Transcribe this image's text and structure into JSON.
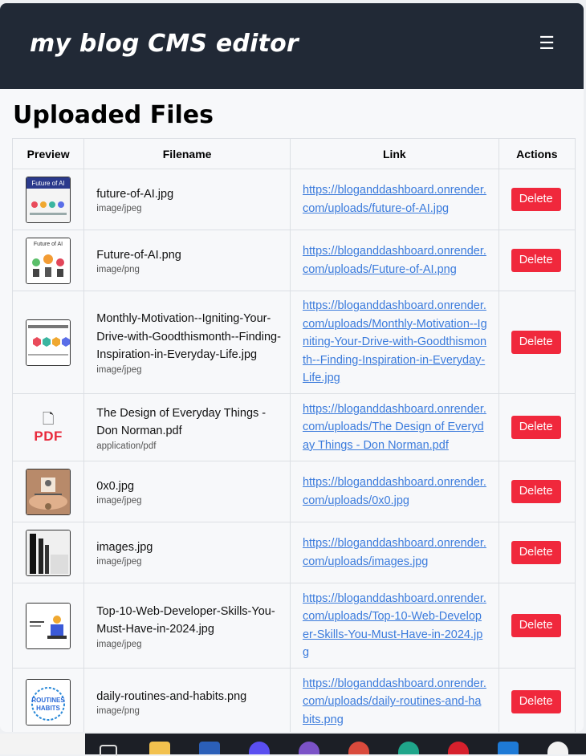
{
  "app": {
    "brand": "my blog CMS editor",
    "menu_glyph": "☰"
  },
  "page": {
    "title": "Uploaded Files"
  },
  "table": {
    "headers": {
      "preview": "Preview",
      "filename": "Filename",
      "link": "Link",
      "actions": "Actions"
    },
    "delete_label": "Delete",
    "rows": [
      {
        "name": "future-of-AI.jpg",
        "type": "image/jpeg",
        "url": "https://bloganddashboard.onrender.com/uploads/future-of-AI.jpg",
        "thumb": "ai-infographic",
        "delete": "Delete"
      },
      {
        "name": "Future-of-AI.png",
        "type": "image/png",
        "url": "https://bloganddashboard.onrender.com/uploads/Future-of-AI.png",
        "thumb": "ai-people",
        "delete": "Delete"
      },
      {
        "name": "Monthly-Motivation--Igniting-Your-Drive-with-Goodthismonth--Finding-Inspiration-in-Everyday-Life.jpg",
        "type": "image/jpeg",
        "url": "https://bloganddashboard.onrender.com/uploads/Monthly-Motivation--Igniting-Your-Drive-with-Goodthismonth--Finding-Inspiration-in-Everyday-Life.jpg",
        "thumb": "hexagons",
        "delete": "Delete"
      },
      {
        "name": "The Design of Everyday Things - Don Norman.pdf",
        "type": "application/pdf",
        "url": "https://bloganddashboard.onrender.com/uploads/The Design of Everyday Things - Don Norman.pdf",
        "thumb": "pdf",
        "pdf_label": "PDF",
        "pdf_glyph": "🗋",
        "delete": "Delete"
      },
      {
        "name": "0x0.jpg",
        "type": "image/jpeg",
        "url": "https://bloganddashboard.onrender.com/uploads/0x0.jpg",
        "thumb": "hands-balance",
        "delete": "Delete"
      },
      {
        "name": "images.jpg",
        "type": "image/jpeg",
        "url": "https://bloganddashboard.onrender.com/uploads/images.jpg",
        "thumb": "dark-bars",
        "delete": "Delete"
      },
      {
        "name": "Top-10-Web-Developer-Skills-You-Must-Have-in-2024.jpg",
        "type": "image/jpeg",
        "url": "https://bloganddashboard.onrender.com/uploads/Top-10-Web-Developer-Skills-You-Must-Have-in-2024.jpg",
        "thumb": "developer",
        "delete": "Delete"
      },
      {
        "name": "daily-routines-and-habits.png",
        "type": "image/png",
        "url": "https://bloganddashboard.onrender.com/uploads/daily-routines-and-habits.png",
        "thumb": "routines",
        "delete": "Delete"
      }
    ]
  },
  "taskbar": {
    "icons": [
      "task-view-icon",
      "file-explorer-icon",
      "word-icon",
      "app-circle-icon",
      "viber-icon",
      "chrome-icon",
      "edge-icon",
      "opera-icon",
      "vscode-icon",
      "app-triangle-icon"
    ]
  },
  "colors": {
    "header_bg": "#212936",
    "delete_bg": "#f0283c",
    "link": "#3b7bdc",
    "pdf_red": "#e8283a"
  }
}
